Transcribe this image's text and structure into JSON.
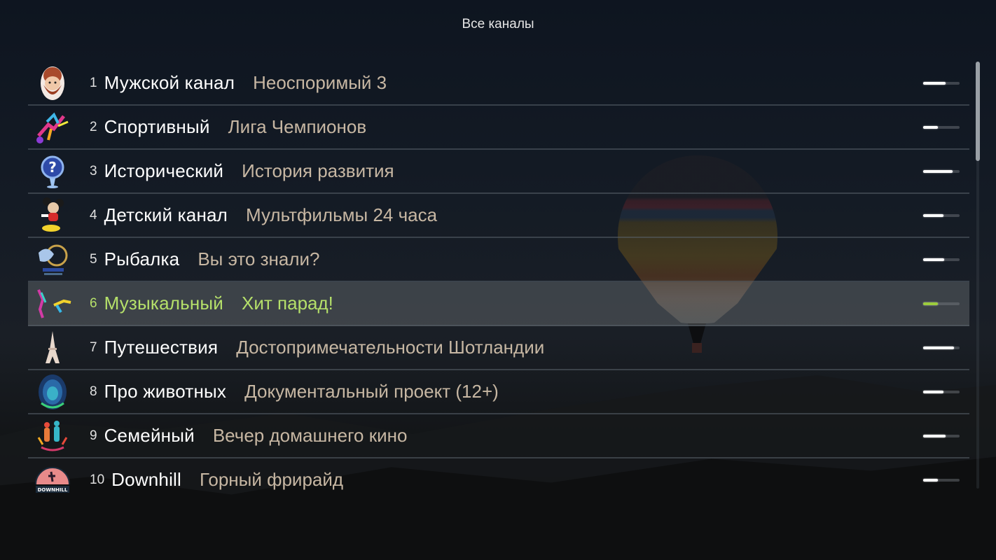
{
  "title": "Все каналы",
  "colors": {
    "selected_text": "#b5e06a",
    "selected_bar": "#9ccc3c",
    "program_text": "#c7b7a3",
    "channel_text": "#ffffff"
  },
  "channels": [
    {
      "number": "1",
      "name": "Мужской канал",
      "program": "Неоспоримый 3",
      "progress": 0.62,
      "icon": "bearded-man-icon",
      "selected": false
    },
    {
      "number": "2",
      "name": "Спортивный",
      "program": "Лига Чемпионов",
      "progress": 0.4,
      "icon": "soccer-player-icon",
      "selected": false
    },
    {
      "number": "3",
      "name": "Исторический",
      "program": "История развития",
      "progress": 0.8,
      "icon": "question-globe-icon",
      "selected": false
    },
    {
      "number": "4",
      "name": "Детский канал",
      "program": "Мультфильмы 24 часа",
      "progress": 0.55,
      "icon": "cartoon-mouse-icon",
      "selected": false
    },
    {
      "number": "5",
      "name": "Рыбалка",
      "program": "Вы это знали?",
      "progress": 0.58,
      "icon": "fishing-emblem-icon",
      "selected": false
    },
    {
      "number": "6",
      "name": "Музыкальный",
      "program": "Хит парад!",
      "progress": 0.4,
      "icon": "dancers-icon",
      "selected": true
    },
    {
      "number": "7",
      "name": "Путешествия",
      "program": "Достопримечательности Шотландии",
      "progress": 0.85,
      "icon": "eiffel-tower-icon",
      "selected": false
    },
    {
      "number": "8",
      "name": "Про животных",
      "program": "Документальный проект (12+)",
      "progress": 0.55,
      "icon": "lion-head-icon",
      "selected": false
    },
    {
      "number": "9",
      "name": "Семейный",
      "program": "Вечер домашнего кино",
      "progress": 0.62,
      "icon": "family-icon",
      "selected": false
    },
    {
      "number": "10",
      "name": "Downhill",
      "program": "Горный фрирайд",
      "progress": 0.4,
      "icon": "downhill-bike-icon",
      "selected": false
    }
  ],
  "scroll": {
    "position": 0.0,
    "visible_fraction": 0.23
  }
}
